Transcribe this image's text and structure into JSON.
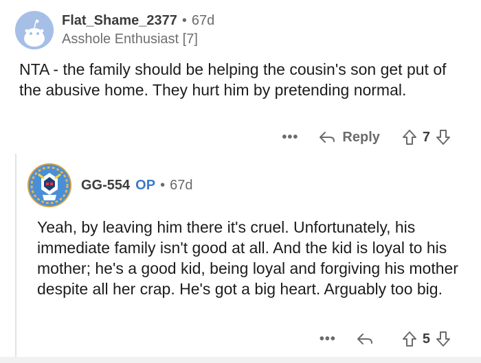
{
  "comments": [
    {
      "username": "Flat_Shame_2377",
      "separator": "•",
      "age": "67d",
      "flair": "Asshole Enthusiast [7]",
      "body": "NTA - the family should be helping the cousin's son get put of the abusive home. They hurt him by pretending normal.",
      "more_label": "•••",
      "reply_label": "Reply",
      "score": "7"
    },
    {
      "username": "GG-554",
      "op_badge": "OP",
      "separator": "•",
      "age": "67d",
      "body": "Yeah, by leaving him there it's cruel. Unfortunately, his immediate family isn't good at all. And the kid is loyal to his mother; he's a good kid, being loyal and forgiving his mother despite all her crap. He's got a big heart. Arguably too big.",
      "more_label": "•••",
      "score": "5"
    }
  ],
  "colors": {
    "op_blue": "#3e79c6",
    "meta_gray": "#6a6a6a",
    "avatar1_bg": "#a6bfe6"
  },
  "icons": [
    "reddit-snoo-avatar-icon",
    "robot-avatar-icon",
    "reply-arrow-icon",
    "upvote-icon",
    "downvote-icon",
    "more-options-icon"
  ]
}
